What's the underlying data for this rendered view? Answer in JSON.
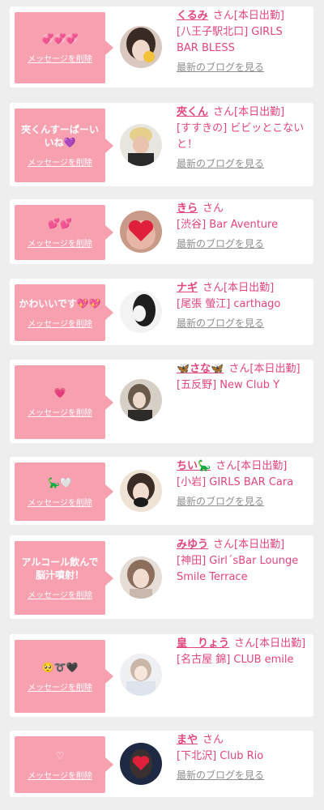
{
  "delete_label": "メッセージを削除",
  "blog_label": "最新のブログを見る",
  "san_label": "さん",
  "accent_color": "#e0457c",
  "bubble_color": "#f7a0b0",
  "cards": [
    {
      "message": "💞💞💞",
      "name": "くるみ",
      "status": "[本日出勤]",
      "shop": "[八王子駅北口] GIRLS BAR BLESS"
    },
    {
      "message": "夾くんすーぱーいいね💜",
      "name": "夾くん",
      "status": "[本日出勤]",
      "shop": "[すすきの] ビビッとこないと！"
    },
    {
      "message": "💕💕",
      "name": "きら",
      "status": "",
      "shop": "[渋谷] Bar Aventure"
    },
    {
      "message": "かわいいです💖💖",
      "name": "ナギ",
      "status": "[本日出勤]",
      "shop": "[尾張 螢江] carthago"
    },
    {
      "message": "💗",
      "name": "🦋さな🦋",
      "status": "[本日出勤]",
      "shop": "[五反野] New Club Y"
    },
    {
      "message": "🦕🤍",
      "name": "ちい🦕",
      "status": "[本日出勤]",
      "shop": "[小岩] GIRLS BAR Cara"
    },
    {
      "message": "アルコール飲んで脳汁噴射！",
      "name": "みゆう",
      "status": "[本日出勤]",
      "shop": "[神田] Girl´sBar Lounge Smile Terrace"
    },
    {
      "message": "🥺➰🖤",
      "name": "皇　りょう",
      "status": "[本日出勤]",
      "shop": "[名古屋 錦] CLUB emile"
    },
    {
      "message": "♡",
      "name": "まや",
      "status": "",
      "shop": "[下北沢] Club Rio"
    }
  ]
}
